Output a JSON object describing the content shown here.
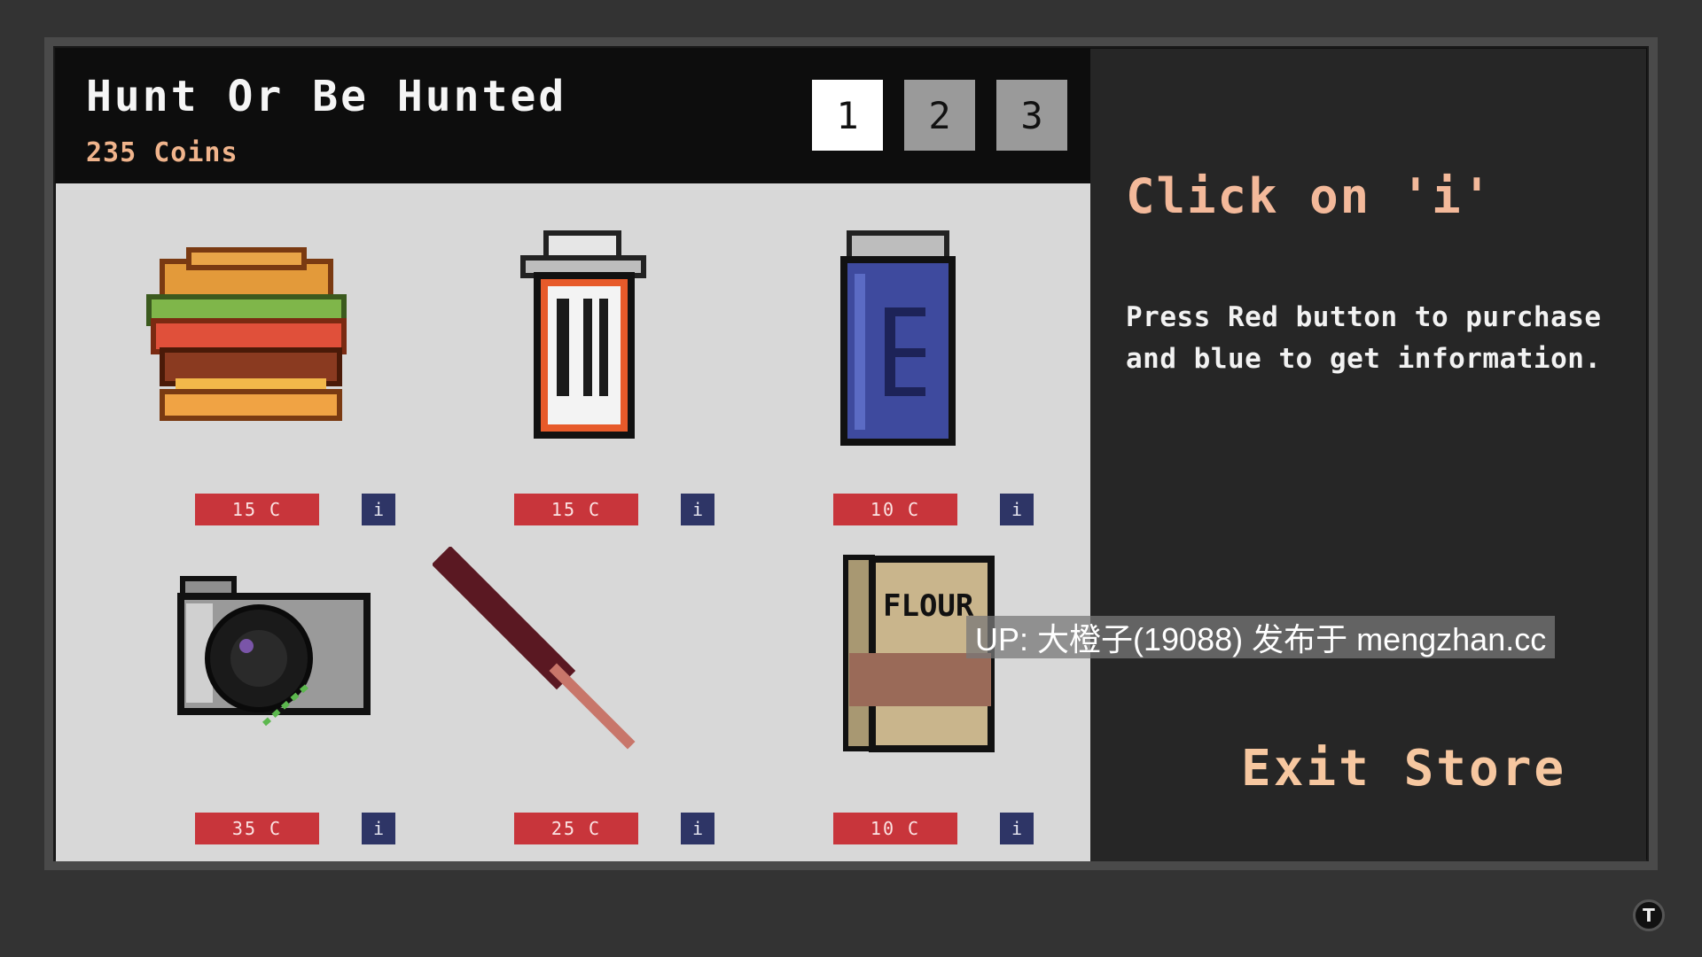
{
  "store": {
    "title": "Hunt Or Be Hunted",
    "coins": "235 Coins",
    "pages": [
      "1",
      "2",
      "3"
    ],
    "active_page": 0
  },
  "items": [
    {
      "name": "burger",
      "price": "15 C",
      "info": "i",
      "icon": "burger-icon"
    },
    {
      "name": "cup",
      "price": "15 C",
      "info": "i",
      "icon": "cup-icon"
    },
    {
      "name": "can",
      "price": "10 C",
      "info": "i",
      "icon": "can-icon"
    },
    {
      "name": "camera",
      "price": "35 C",
      "info": "i",
      "icon": "camera-icon"
    },
    {
      "name": "bat",
      "price": "25 C",
      "info": "i",
      "icon": "bat-icon"
    },
    {
      "name": "flour",
      "price": "10 C",
      "info": "i",
      "icon": "flour-bag-icon",
      "label": "FLOUR"
    }
  ],
  "hint": {
    "title": "Click on 'i'",
    "body": "Press Red button to purchase and blue to get information."
  },
  "exit_label": "Exit Store",
  "watermark": "UP: 大橙子(19088) 发布于 mengzhan.cc",
  "colors": {
    "price_button": "#c8353b",
    "info_button": "#2e3566",
    "coins_text": "#f0b48c",
    "hint_title": "#f3b99a"
  }
}
